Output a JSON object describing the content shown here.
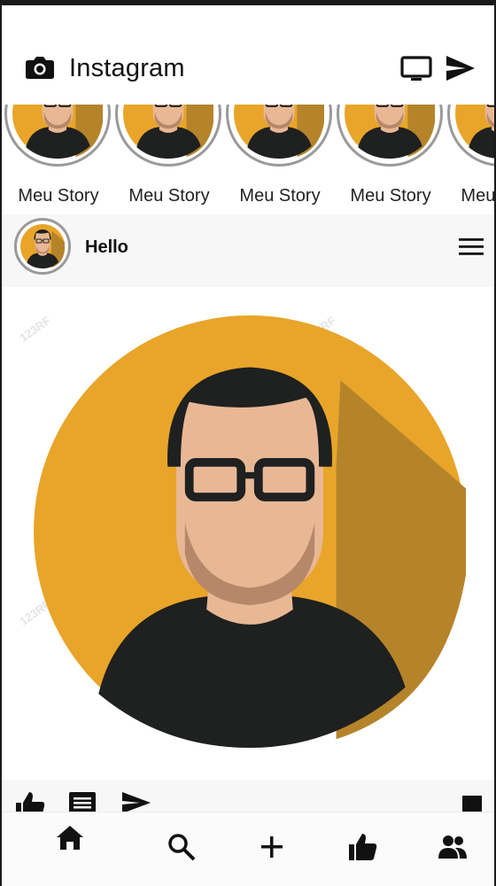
{
  "app": {
    "title": "Instagram",
    "icons": {
      "camera": "camera-icon",
      "tv": "tv-icon",
      "direct": "send-icon"
    }
  },
  "stories": [
    {
      "label": "Meu Story"
    },
    {
      "label": "Meu Story"
    },
    {
      "label": "Meu Story"
    },
    {
      "label": "Meu Story"
    },
    {
      "label": "Meu Story"
    }
  ],
  "post": {
    "username": "Hello",
    "watermark": "123RF"
  },
  "actions": {
    "like": "like-icon",
    "comment": "comment-icon",
    "share": "send-icon",
    "bookmark": "bookmark-icon"
  },
  "nav": {
    "items": [
      "home-icon",
      "search-icon",
      "add-icon",
      "like-icon",
      "people-icon"
    ]
  },
  "colors": {
    "avatar_bg": "#E8A52A",
    "avatar_shadow": "#B5842A",
    "shirt": "#1F2020",
    "skin": "#E8B895",
    "beard": "#B7876A",
    "hair": "#1F2020"
  }
}
